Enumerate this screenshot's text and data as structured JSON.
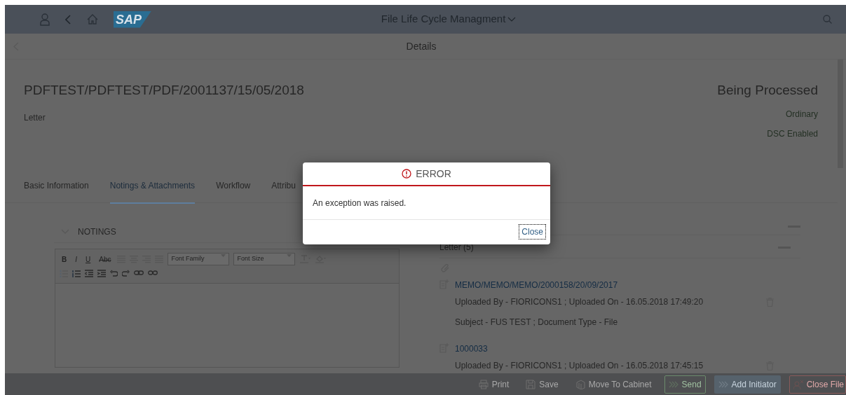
{
  "shell": {
    "logo": "SAP",
    "title": "File Life Cycle Managment"
  },
  "subheader": {
    "title": "Details"
  },
  "object_header": {
    "title": "PDFTEST/PDFTEST/PDF/2001137/15/05/2018",
    "subtitle": "Letter",
    "status": "Being Processed",
    "attributes": [
      "Ordinary",
      "DSC Enabled"
    ]
  },
  "tabs": [
    {
      "label": "Basic Information",
      "selected": false
    },
    {
      "label": "Notings & Attachments",
      "selected": true
    },
    {
      "label": "Workflow",
      "selected": false
    },
    {
      "label": "Attribu",
      "selected": false
    }
  ],
  "notings": {
    "title": "NOTINGS",
    "expanded": true,
    "format_buttons": [
      "B",
      "I",
      "U",
      "Abc"
    ],
    "dropdowns": [
      "Font Family",
      "Font Size"
    ]
  },
  "attachments": {
    "group": "Letter (5)",
    "items": [
      {
        "link": "MEMO/MEMO/MEMO/2000158/20/09/2017",
        "uploaded": "Uploaded By - FIORICONS1 ; Uploaded On - 16.05.2018 17:49:20",
        "subject": "Subject - FUS TEST ; Document Type - File"
      },
      {
        "link": "1000033",
        "uploaded": "Uploaded By - FIORICONS1 ; Uploaded On - 16.05.2018 17:45:15"
      }
    ]
  },
  "footer": {
    "buttons": [
      {
        "label": "Print",
        "kind": "print"
      },
      {
        "label": "Save",
        "kind": "save"
      },
      {
        "label": "Move To Cabinet",
        "kind": "cabinet"
      },
      {
        "label": "Send",
        "kind": "send"
      },
      {
        "label": "Add Initiator",
        "kind": "initiator"
      },
      {
        "label": "Close File",
        "kind": "reject"
      }
    ]
  },
  "dialog": {
    "title": "ERROR",
    "message": "An exception was raised.",
    "button": "Close"
  }
}
